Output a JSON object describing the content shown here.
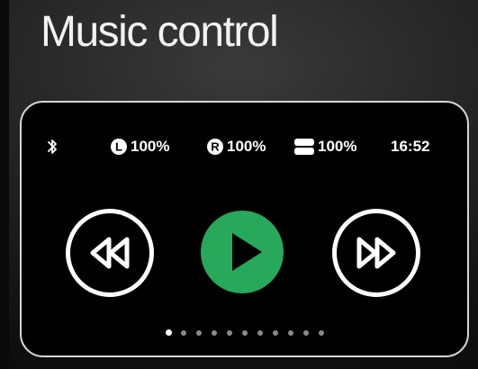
{
  "title": "Music control",
  "status_bar": {
    "left_battery": "100%",
    "right_battery": "100%",
    "case_battery": "100%",
    "time": "16:52",
    "left_letter": "L",
    "right_letter": "R"
  },
  "controls": {
    "previous_icon": "rewind-icon",
    "play_icon": "play-icon",
    "next_icon": "fast-forward-icon"
  },
  "pagination": {
    "total_pages": 11,
    "current_page": 1
  },
  "colors": {
    "play_accent": "#27a85a",
    "card_border": "#d6d6d6",
    "dot_inactive": "#8a8a8a",
    "dot_active": "#ffffff"
  }
}
